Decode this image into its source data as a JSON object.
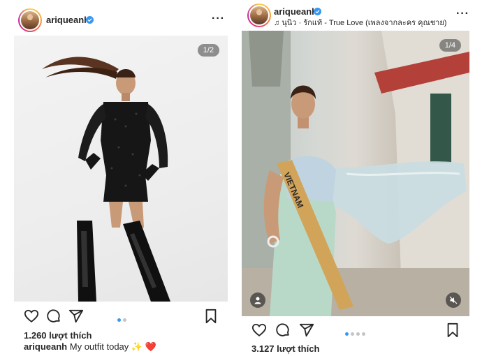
{
  "posts": [
    {
      "username": "ariqueanh",
      "verified": true,
      "counter": "1/2",
      "likes": "1.260 lượt thích",
      "caption_user": "ariqueanh",
      "caption_text": "My outfit today ✨ ❤️",
      "dots": 2,
      "active_dot": 0
    },
    {
      "username": "ariqueanh",
      "verified": true,
      "music": "นุนิว · รักแท้ - True Love (เพลงจากละคร คุณชาย)",
      "counter": "1/4",
      "likes": "3.127 lượt thích",
      "sash_text": "VIETNAM",
      "dots": 4,
      "active_dot": 0
    }
  ],
  "icons": [
    "heart-icon",
    "comment-icon",
    "share-icon",
    "bookmark-icon",
    "more-icon",
    "music-note-icon",
    "user-tag-icon",
    "mute-icon",
    "verified-badge-icon"
  ],
  "colors": {
    "accent": "#3897f0",
    "text": "#262626",
    "dot_inactive": "#c4c4c4"
  }
}
